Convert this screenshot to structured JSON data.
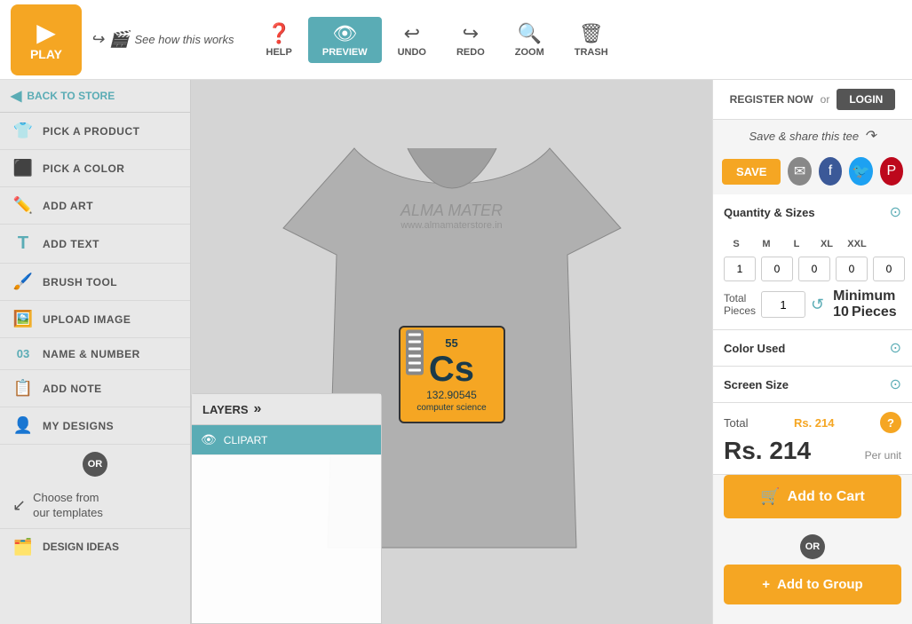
{
  "topbar": {
    "play_label": "PLAY",
    "see_how": "See how this works",
    "help_label": "HELP",
    "preview_label": "PREVIEW",
    "undo_label": "UNDO",
    "redo_label": "REDO",
    "zoom_label": "ZOOM",
    "trash_label": "TRASH"
  },
  "sidebar": {
    "back_label": "BACK TO STORE",
    "items": [
      {
        "id": "pick-product",
        "label": "PICK A PRODUCT",
        "icon": "👕"
      },
      {
        "id": "pick-color",
        "label": "PICK A COLOR",
        "icon": "🎨"
      },
      {
        "id": "add-art",
        "label": "ADD ART",
        "icon": "✏️"
      },
      {
        "id": "add-text",
        "label": "ADD TEXT",
        "icon": "T"
      },
      {
        "id": "brush-tool",
        "label": "BRUSH TOOL",
        "icon": "🖌️"
      },
      {
        "id": "upload-image",
        "label": "UPLOAD IMAGE",
        "icon": "🖼️"
      },
      {
        "id": "name-number",
        "label": "NAME & NUMBER",
        "icon": "03"
      },
      {
        "id": "add-note",
        "label": "ADD NOTE",
        "icon": "📝"
      },
      {
        "id": "my-designs",
        "label": "MY DESIGNS",
        "icon": "👤"
      }
    ],
    "or_label": "OR",
    "choose_templates": "Choose from\nour templates",
    "design_ideas_label": "DESIGN IDEAS",
    "design_ideas_icon": "🗂️"
  },
  "layers": {
    "title": "LAYERS",
    "items": [
      {
        "id": "clipart-layer",
        "label": "CLIPART",
        "active": true
      }
    ]
  },
  "tshirt": {
    "brand_name": "ALMA MATER",
    "brand_url": "www.almamaterstore.in",
    "clipart": {
      "number": "55",
      "symbol": "Cs",
      "mass": "132.90545",
      "label": "computer science"
    }
  },
  "right_panel": {
    "register_label": "REGISTER NOW",
    "or_text": "or",
    "login_label": "LOGIN",
    "save_share_text": "Save & share this tee",
    "save_label": "SAVE",
    "quantity_title": "Quantity & Sizes",
    "sizes": [
      {
        "label": "S",
        "value": "1"
      },
      {
        "label": "M",
        "value": "0"
      },
      {
        "label": "L",
        "value": "0"
      },
      {
        "label": "XL",
        "value": "0"
      },
      {
        "label": "XXL",
        "value": "0"
      }
    ],
    "total_pieces_label": "Total\nPieces",
    "total_value": "1",
    "minimum_label": "Minimum",
    "minimum_value": "10",
    "minimum_pieces": "Pieces",
    "color_used_title": "Color Used",
    "screen_size_title": "Screen Size",
    "total_label": "Total",
    "price_highlighted": "Rs. 214",
    "price_big": "Rs. 214",
    "per_unit_label": "Per unit",
    "add_to_cart_label": "Add to Cart",
    "or_label": "OR",
    "add_to_group_label": "Add to Group"
  }
}
